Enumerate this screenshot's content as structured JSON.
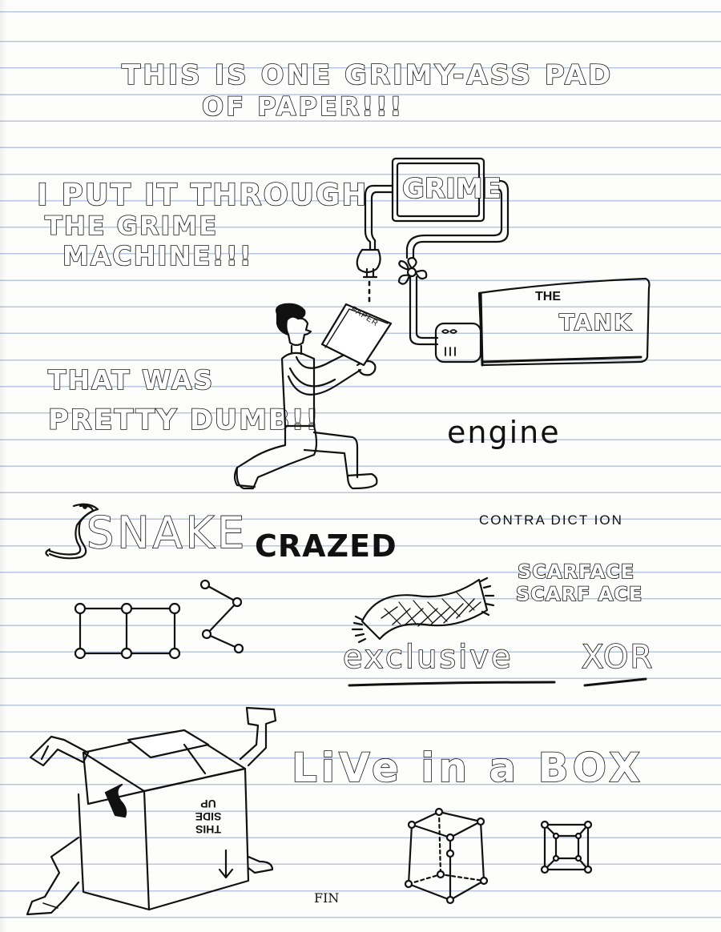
{
  "title": {
    "line1": "THIS IS ONE  GRIMY-ASS PAD",
    "line2": "OF PAPER!!!"
  },
  "machine_caption": [
    "I PUT IT THROUGH",
    "THE GRIME",
    "MACHINE!!!"
  ],
  "machine": {
    "grime_label": "GRIME",
    "tank_label_1": "THE",
    "tank_label_2": "TANK",
    "paper_label": "PAPER"
  },
  "dumb_caption": [
    "THAT WAS",
    "PRETTY DUMB!!"
  ],
  "engine": "engine",
  "snake": "SNAKE",
  "crazed": "CRAZED",
  "contradiction": "CONTRA DICT ION",
  "scarface": [
    "SCARFACE",
    "SCARF ACE"
  ],
  "exclusive": "exclusive",
  "xor": "XOR",
  "live_in_a_box": "LiVe in a BOX",
  "box_label": [
    "THIS",
    "SIDE",
    "UP"
  ],
  "fin": "FIN"
}
